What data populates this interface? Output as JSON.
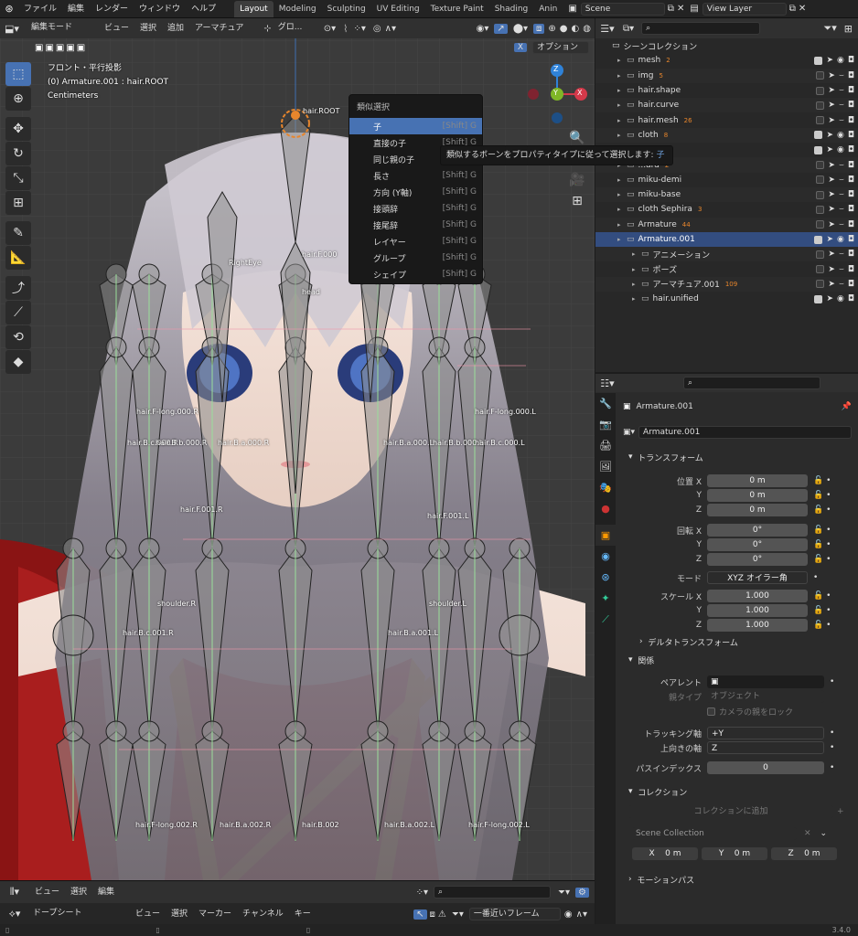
{
  "topbar": {
    "menus": [
      "ファイル",
      "編集",
      "レンダー",
      "ウィンドウ",
      "ヘルプ"
    ],
    "workspaces": [
      "Layout",
      "Modeling",
      "Sculpting",
      "UV Editing",
      "Texture Paint",
      "Shading",
      "Anin"
    ],
    "active_workspace": "Layout",
    "scene": "Scene",
    "view_layer": "View Layer"
  },
  "viewport": {
    "mode": "編集モード",
    "menus": [
      "ビュー",
      "選択",
      "追加",
      "アーマチュア"
    ],
    "transform_orientation": "グロ...",
    "options_label": "オプション",
    "x_mirror": "X",
    "overlay_lines": [
      "フロント・平行投影",
      "(0) Armature.001 : hair.ROOT",
      "Centimeters"
    ],
    "gizmo_axes": {
      "x": "X",
      "y": "Y",
      "z": "Z"
    },
    "colors": {
      "x": "#d4394a",
      "y": "#7fb627",
      "z": "#2f82d8",
      "selected": "#4772b3",
      "active_bone": "#e8862c"
    }
  },
  "select_similar_menu": {
    "title": "類似選択",
    "items": [
      {
        "label": "子",
        "shortcut": "[Shift] G"
      },
      {
        "label": "直接の子",
        "shortcut": "[Shift] G"
      },
      {
        "label": "同じ親の子",
        "shortcut": "[Shift] G"
      },
      {
        "label": "長さ",
        "shortcut": "[Shift] G"
      },
      {
        "label": "方向 (Y軸)",
        "shortcut": "[Shift] G"
      },
      {
        "label": "接頭辞",
        "shortcut": "[Shift] G"
      },
      {
        "label": "接尾辞",
        "shortcut": "[Shift] G"
      },
      {
        "label": "レイヤー",
        "shortcut": "[Shift] G"
      },
      {
        "label": "グループ",
        "shortcut": "[Shift] G"
      },
      {
        "label": "シェイプ",
        "shortcut": "[Shift] G"
      }
    ],
    "tooltip_text": "類似するボーンをプロパティタイプに従って選択します:",
    "tooltip_value": "子"
  },
  "bone_labels": [
    "hair.ROOT",
    "RightEye",
    "hair.F.000",
    "head",
    "hair.F-long.000.R",
    "hair.F-long.000.L",
    "hair.B.c.000.R",
    "hair.B.b.000.R",
    "hair.B.a.000.R",
    "hair.B.a.000.L",
    "hair.B.b.000.L",
    "hair.B.c.000.L",
    "hair.F.001.R",
    "hair.F.001.L",
    "shoulder.L",
    "shoulder.R",
    "hair.B.c.001.R",
    "hair.B.a.001.L",
    "hair.B.002",
    "hair.B.a.002.R",
    "hair.B.a.002.L",
    "hair.F-long.002.L",
    "hair.F-long.002.R"
  ],
  "outliner": {
    "search_placeholder": "",
    "collection": "シーンコレクション",
    "rows": [
      {
        "name": "mesh",
        "count": "2",
        "visible": true
      },
      {
        "name": "img",
        "count": "5",
        "visible": false
      },
      {
        "name": "hair.shape",
        "count": "",
        "visible": false
      },
      {
        "name": "hair.curve",
        "count": "",
        "visible": false
      },
      {
        "name": "hair.mesh",
        "count": "26",
        "visible": false
      },
      {
        "name": "cloth",
        "count": "8",
        "visible": true
      },
      {
        "name": "",
        "count": "4",
        "visible": true
      },
      {
        "name": "...ard",
        "count": "2",
        "visible": false
      },
      {
        "name": "miku-demi",
        "count": "",
        "visible": false
      },
      {
        "name": "miku-base",
        "count": "",
        "visible": false
      },
      {
        "name": "cloth Sephira",
        "count": "3",
        "visible": false
      },
      {
        "name": "Armature",
        "count": "44",
        "visible": false
      },
      {
        "name": "Armature.001",
        "count": "",
        "visible": true,
        "selected": true
      },
      {
        "name": "アニメーション",
        "count": "",
        "visible": false
      },
      {
        "name": "ポーズ",
        "count": "",
        "visible": false
      },
      {
        "name": "アーマチュア.001",
        "count": "109",
        "visible": false
      },
      {
        "name": "hair.unified",
        "count": "",
        "visible": true
      }
    ]
  },
  "properties": {
    "object_name": "Armature.001",
    "object_field": "Armature.001",
    "transform_header": "トランスフォーム",
    "location_label": "位置 X",
    "location": [
      "0 m",
      "0 m",
      "0 m"
    ],
    "rotation_label": "回転 X",
    "rotation": [
      "0°",
      "0°",
      "0°"
    ],
    "mode_label": "モード",
    "mode_value": "XYZ オイラー角",
    "scale_label": "スケール X",
    "scale": [
      "1.000",
      "1.000",
      "1.000"
    ],
    "delta_transform": "デルタトランスフォーム",
    "relations_header": "関係",
    "parent_label": "ペアレント",
    "parent_type_label": "親タイプ",
    "parent_type_value": "オブジェクト",
    "camera_parent_lock": "カメラの親をロック",
    "tracking_axis_label": "トラッキング軸",
    "tracking_axis_value": "+Y",
    "up_axis_label": "上向きの軸",
    "up_axis_value": "Z",
    "pass_index_label": "パスインデックス",
    "pass_index_value": "0",
    "collection_header": "コレクション",
    "add_to_collection": "コレクションに追加",
    "scene_collection": "Scene Collection",
    "xyz": [
      {
        "axis": "X",
        "value": "0 m"
      },
      {
        "axis": "Y",
        "value": "0 m"
      },
      {
        "axis": "Z",
        "value": "0 m"
      }
    ],
    "motion_path": "モーションパス",
    "axis_labels": [
      "Y",
      "Z",
      "Y",
      "Z",
      "Y",
      "Z"
    ]
  },
  "bottom": {
    "timeline_menus": [
      "ビュー",
      "選択",
      "編集"
    ],
    "dopesheet_mode": "ドープシート",
    "dopesheet_menus": [
      "ビュー",
      "選択",
      "マーカー",
      "チャンネル",
      "キー"
    ],
    "snap_mode": "一番近いフレーム",
    "version": "3.4.0"
  }
}
